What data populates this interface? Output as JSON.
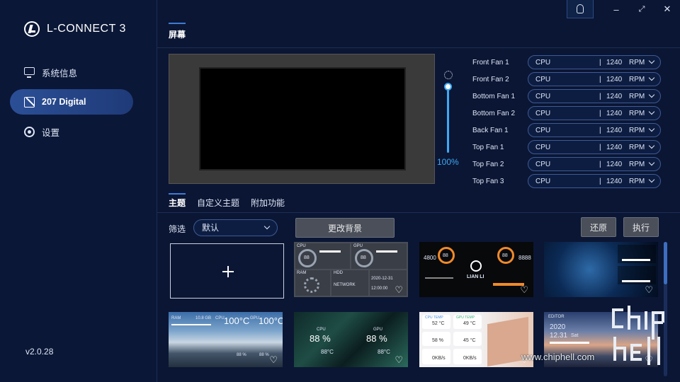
{
  "app": {
    "title": "L-CONNECT 3",
    "version": "v2.0.28"
  },
  "sidebar": {
    "items": [
      {
        "label": "系统信息",
        "icon": "monitor-icon"
      },
      {
        "label": "207 Digital",
        "icon": "screen-icon",
        "active": true
      },
      {
        "label": "设置",
        "icon": "gear-icon"
      }
    ]
  },
  "header": {
    "title": "屏幕"
  },
  "brightness": {
    "value": "100%",
    "level": 1.0
  },
  "fans": [
    {
      "name": "Front Fan 1",
      "source": "CPU",
      "sep": "|",
      "rpm": "1240",
      "unit": "RPM"
    },
    {
      "name": "Front Fan 2",
      "source": "CPU",
      "sep": "|",
      "rpm": "1240",
      "unit": "RPM"
    },
    {
      "name": "Bottom Fan 1",
      "source": "CPU",
      "sep": "|",
      "rpm": "1240",
      "unit": "RPM"
    },
    {
      "name": "Bottom Fan 2",
      "source": "CPU",
      "sep": "|",
      "rpm": "1240",
      "unit": "RPM"
    },
    {
      "name": "Back Fan 1",
      "source": "CPU",
      "sep": "|",
      "rpm": "1240",
      "unit": "RPM"
    },
    {
      "name": "Top Fan 1",
      "source": "CPU",
      "sep": "|",
      "rpm": "1240",
      "unit": "RPM"
    },
    {
      "name": "Top Fan 2",
      "source": "CPU",
      "sep": "|",
      "rpm": "1240",
      "unit": "RPM"
    },
    {
      "name": "Top Fan 3",
      "source": "CPU",
      "sep": "|",
      "rpm": "1240",
      "unit": "RPM"
    }
  ],
  "tabs": [
    {
      "label": "主题",
      "active": true
    },
    {
      "label": "自定义主题"
    },
    {
      "label": "附加功能"
    }
  ],
  "filter": {
    "label": "筛选",
    "value": "默认"
  },
  "buttons": {
    "change_bg": "更改背景",
    "restore": "还原",
    "apply": "执行"
  },
  "themes": {
    "t1": {
      "cpu": "CPU",
      "gpu": "GPU",
      "ram": "RAM",
      "hdd": "HDD",
      "network": "NETWORK",
      "date": "2020-12-31",
      "time": "12:00:00",
      "val": "88"
    },
    "t2": {
      "brand": "LIAN LI",
      "left_val": "4800",
      "right_val": "8888",
      "gauge": "88"
    },
    "t4": {
      "ram": "RAM",
      "ram_val": "10.8 GB",
      "cpu": "CPU",
      "cpu_val": "100°C",
      "gpu": "GPU",
      "gpu_val": "100°C",
      "small1": "88 %",
      "small2": "88 %"
    },
    "t5": {
      "v1": "88 %",
      "v2": "88 %",
      "t1": "88°C",
      "t2": "88°C",
      "cpu": "CPU",
      "gpu": "GPU"
    },
    "t6": {
      "cpu_temp": "52 °C",
      "gpu_temp": "49 °C",
      "ram": "58 %",
      "gpu_usage": "45 °C",
      "upload": "0KB/s",
      "download": "0KB/s",
      "cpu_label": "CPU TEMP",
      "gpu_label": "GPU TEMP"
    },
    "t7": {
      "year": "2020",
      "date": "12.31",
      "day": "Sat",
      "label": "EDITOR"
    }
  },
  "watermark": {
    "text": "www.chiphell.com"
  },
  "colors": {
    "accent": "#3fa8f5",
    "active_nav": "#2b4f96",
    "bg": "#0b1634"
  }
}
